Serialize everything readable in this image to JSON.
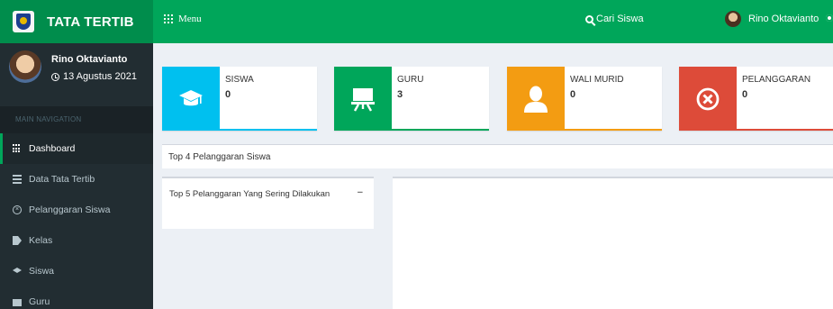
{
  "app": {
    "logo_text": "TATA TERTIB",
    "brand_color": "#008d4c",
    "header_color": "#00a65a"
  },
  "topnav": {
    "menu_label": "Menu",
    "search_label": "Cari Siswa",
    "user_label": "Rino Oktavianto"
  },
  "sidebar": {
    "user_name": "Rino Oktavianto",
    "date": "13 Agustus 2021",
    "nav_header": "MAIN NAVIGATION",
    "items": [
      {
        "label": "Dashboard",
        "icon": "dashboard-grid-icon",
        "active": true
      },
      {
        "label": "Data Tata Tertib",
        "icon": "list-icon"
      },
      {
        "label": "Pelanggaran Siswa",
        "icon": "circle-x-icon"
      },
      {
        "label": "Kelas",
        "icon": "tag-icon"
      },
      {
        "label": "Siswa",
        "icon": "graduation-cap-icon"
      },
      {
        "label": "Guru",
        "icon": "board-icon"
      }
    ]
  },
  "stats": [
    {
      "title": "SISWA",
      "value": "0",
      "icon": "graduation-cap-icon",
      "color": "#00c0ef"
    },
    {
      "title": "GURU",
      "value": "3",
      "icon": "teacher-board-icon",
      "color": "#00a65a"
    },
    {
      "title": "WALI MURID",
      "value": "0",
      "icon": "user-icon",
      "color": "#f39c12"
    },
    {
      "title": "PELANGGARAN",
      "value": "0",
      "icon": "times-circle-icon",
      "color": "#dd4b39"
    }
  ],
  "panels": {
    "top4_title": "Top 4 Pelanggaran Siswa",
    "top5_title": "Top 5 Pelanggaran Yang Sering Dilakukan",
    "collapse_symbol": "−"
  }
}
